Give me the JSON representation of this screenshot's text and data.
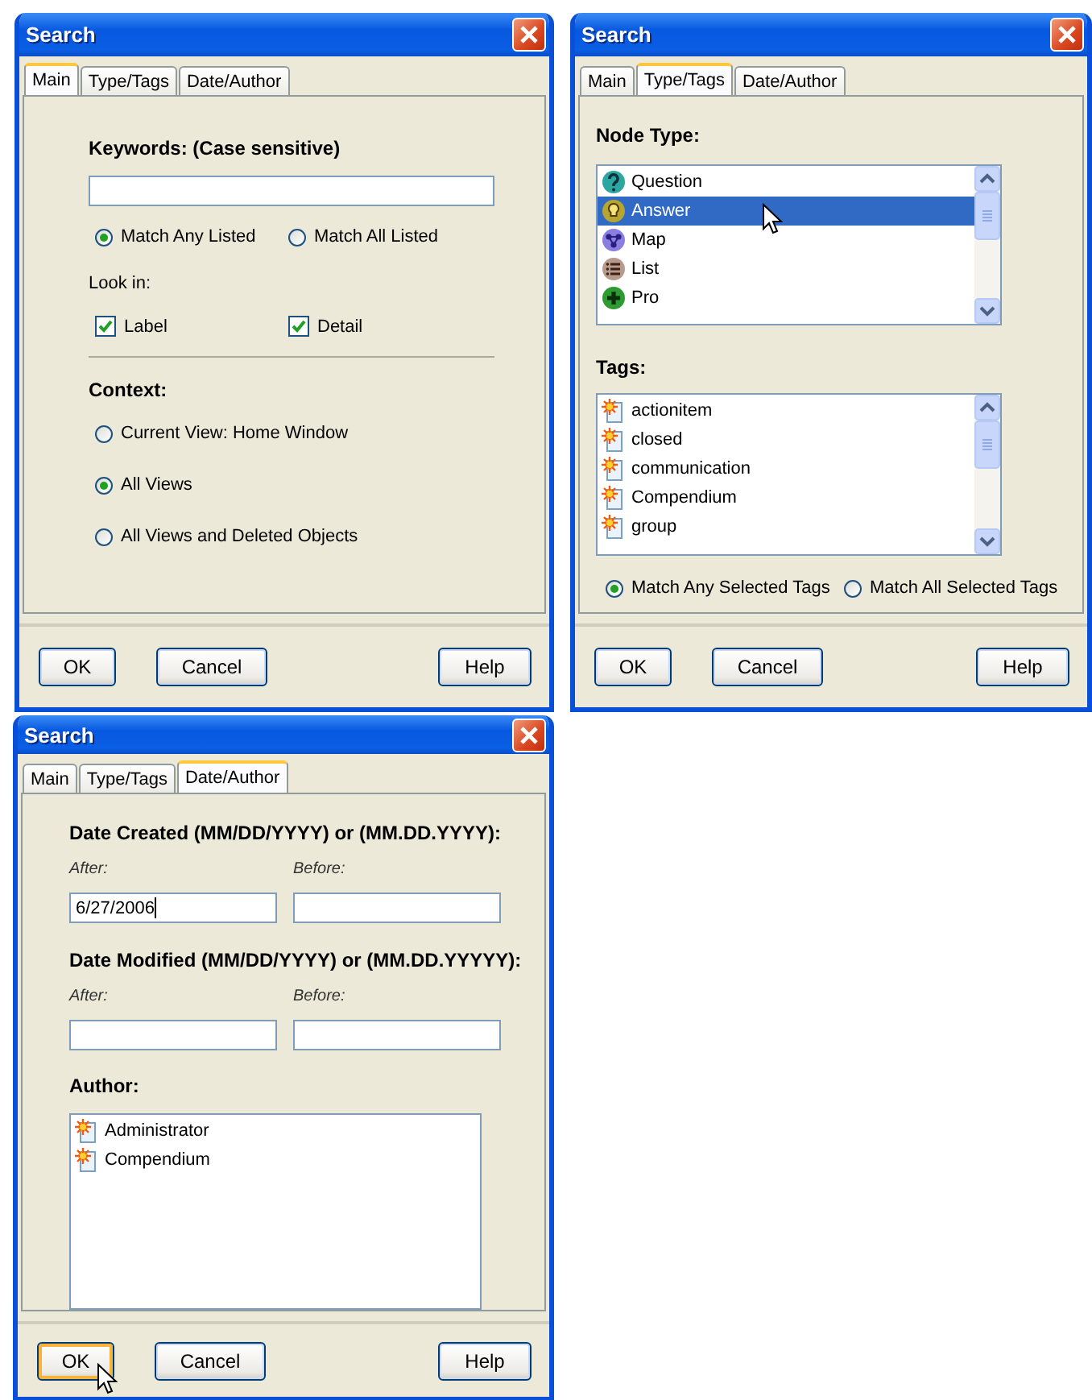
{
  "dialogs": [
    {
      "kind": "main",
      "title": "Search",
      "tabs": [
        {
          "label": "Main",
          "selected": true
        },
        {
          "label": "Type/Tags",
          "selected": false
        },
        {
          "label": "Date/Author",
          "selected": false
        }
      ],
      "keywords_label": "Keywords:  (Case sensitive)",
      "match_options": [
        {
          "label": "Match Any Listed",
          "selected": true
        },
        {
          "label": "Match All Listed",
          "selected": false
        }
      ],
      "look_in_label": "Look in:",
      "look_in": [
        {
          "label": "Label",
          "checked": true
        },
        {
          "label": "Detail",
          "checked": true
        }
      ],
      "context_label": "Context:",
      "context_options": [
        {
          "label": "Current View: Home Window",
          "selected": false
        },
        {
          "label": "All Views",
          "selected": true
        },
        {
          "label": "All Views and Deleted Objects",
          "selected": false
        }
      ],
      "buttons": [
        {
          "label": "OK",
          "hovered": false
        },
        {
          "label": "Cancel",
          "hovered": false
        },
        {
          "label": "Help",
          "hovered": false
        }
      ]
    },
    {
      "kind": "type_tags",
      "title": "Search",
      "tabs": [
        {
          "label": "Main",
          "selected": false
        },
        {
          "label": "Type/Tags",
          "selected": true
        },
        {
          "label": "Date/Author",
          "selected": false
        }
      ],
      "node_type_label": "Node Type:",
      "node_types": [
        {
          "label": "Question",
          "kind": "question",
          "selected": false,
          "hovered": false
        },
        {
          "label": "Answer",
          "kind": "answer",
          "selected": true,
          "hovered": true
        },
        {
          "label": "Map",
          "kind": "map",
          "selected": false,
          "hovered": false
        },
        {
          "label": "List",
          "kind": "list",
          "selected": false,
          "hovered": false
        },
        {
          "label": "Pro",
          "kind": "pro",
          "selected": false,
          "hovered": false
        }
      ],
      "tags_label": "Tags:",
      "tags": [
        {
          "label": "actionitem",
          "selected": false
        },
        {
          "label": "closed",
          "selected": false
        },
        {
          "label": "communication",
          "selected": false
        },
        {
          "label": "Compendium",
          "selected": false
        },
        {
          "label": "group",
          "selected": false
        }
      ],
      "match_options": [
        {
          "label": "Match Any Selected Tags",
          "selected": true
        },
        {
          "label": "Match All Selected Tags",
          "selected": false
        }
      ],
      "buttons": [
        {
          "label": "OK",
          "hovered": false
        },
        {
          "label": "Cancel",
          "hovered": false
        },
        {
          "label": "Help",
          "hovered": false
        }
      ]
    },
    {
      "kind": "date_author",
      "title": "Search",
      "tabs": [
        {
          "label": "Main",
          "selected": false
        },
        {
          "label": "Type/Tags",
          "selected": false
        },
        {
          "label": "Date/Author",
          "selected": true
        }
      ],
      "created": {
        "label": "Date Created (MM/DD/YYYY) or (MM.DD.YYYY):",
        "after_label": "After:",
        "after_value": "6/27/2006",
        "after_focused": true,
        "before_label": "Before:"
      },
      "modified": {
        "label": "Date Modified (MM/DD/YYYY) or (MM.DD.YYYYY):",
        "after_label": "After:",
        "after_focused": false,
        "before_label": "Before:"
      },
      "author_label": "Author:",
      "authors": [
        {
          "label": "Administrator",
          "selected": false
        },
        {
          "label": "Compendium",
          "selected": false
        }
      ],
      "buttons": [
        {
          "label": "OK",
          "hovered": true
        },
        {
          "label": "Cancel",
          "hovered": false
        },
        {
          "label": "Help",
          "hovered": false
        }
      ]
    }
  ]
}
